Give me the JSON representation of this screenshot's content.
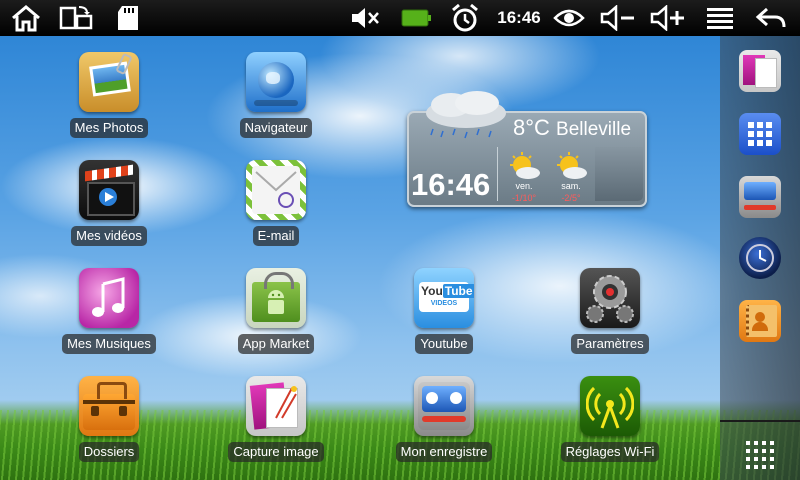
{
  "status_bar": {
    "time": "16:46",
    "icons": [
      "home-icon",
      "screen-rotate-icon",
      "sd-card-icon",
      "mute-icon",
      "battery-icon",
      "alarm-icon",
      "eye-icon",
      "volume-down-icon",
      "volume-up-icon",
      "menu-icon",
      "back-icon"
    ],
    "battery_color": "#56b11a"
  },
  "weather": {
    "temperature": "8°C",
    "city": "Belleville",
    "clock": "16:46",
    "forecast": [
      {
        "day": "ven.",
        "temps": "-1/10°"
      },
      {
        "day": "sam.",
        "temps": "-2/5°"
      }
    ]
  },
  "apps": [
    {
      "label": "Mes Photos"
    },
    {
      "label": "Navigateur"
    },
    {
      "label": "Mes vidéos"
    },
    {
      "label": "E-mail"
    },
    {
      "label": "Mes Musiques"
    },
    {
      "label": "App Market"
    },
    {
      "label": "Youtube"
    },
    {
      "label": "Paramètres"
    },
    {
      "label": "Dossiers"
    },
    {
      "label": "Capture image"
    },
    {
      "label": "Mon enregistre"
    },
    {
      "label": "Réglages Wi-Fi"
    }
  ],
  "youtube_logo": {
    "you": "You",
    "tube": "Tube",
    "sub": "VIDEOS"
  },
  "dock": {
    "items": [
      "capture-image-icon",
      "app-grid-icon",
      "recorder-icon",
      "clock-app-icon",
      "contacts-icon",
      "all-apps-icon"
    ]
  }
}
